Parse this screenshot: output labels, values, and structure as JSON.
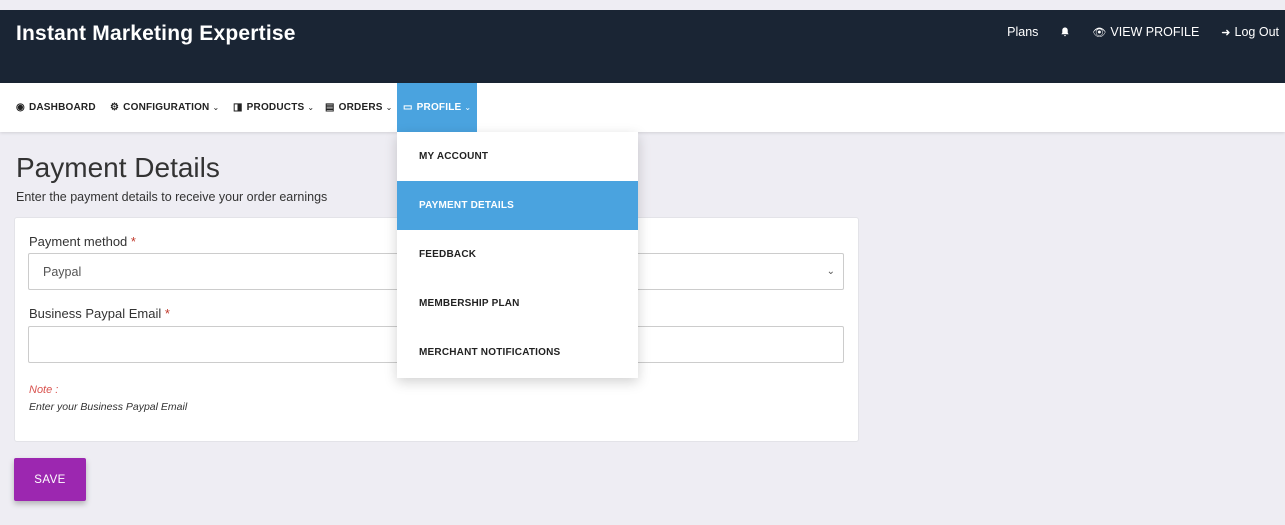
{
  "header": {
    "brand": "Instant Marketing Expertise",
    "links": {
      "plans": "Plans",
      "view_profile": "VIEW PROFILE",
      "logout": "Log Out"
    }
  },
  "nav": {
    "items": [
      {
        "label": "DASHBOARD",
        "icon": "dashboard-icon"
      },
      {
        "label": "CONFIGURATION",
        "icon": "gear-icon"
      },
      {
        "label": "PRODUCTS",
        "icon": "tag-icon"
      },
      {
        "label": "ORDERS",
        "icon": "clipboard-icon"
      },
      {
        "label": "PROFILE",
        "icon": "id-card-icon"
      }
    ],
    "active_item": "PROFILE",
    "active_color": "#4aa3df"
  },
  "profile_menu": {
    "items": [
      "MY ACCOUNT",
      "PAYMENT DETAILS",
      "FEEDBACK",
      "MEMBERSHIP PLAN",
      "MERCHANT NOTIFICATIONS"
    ],
    "selected": "PAYMENT DETAILS"
  },
  "page": {
    "title": "Payment Details",
    "subtitle": "Enter the payment details to receive your order earnings"
  },
  "form": {
    "method_label": "Payment method",
    "method_value": "Paypal",
    "email_label": "Business Paypal Email",
    "email_value": "",
    "required_mark": "*",
    "note_label": "Note :",
    "note_text": "Enter your Business Paypal Email"
  },
  "actions": {
    "save_label": "SAVE",
    "save_color": "#9c27b0"
  }
}
